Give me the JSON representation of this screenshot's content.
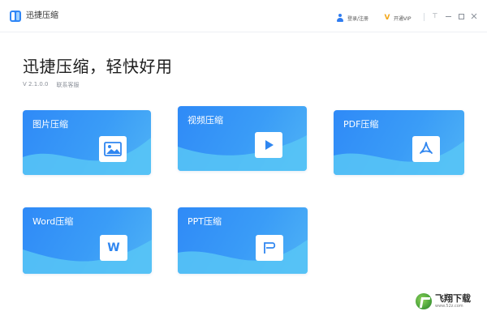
{
  "app": {
    "title": "迅捷压缩"
  },
  "titlebar": {
    "login_label": "登录/注册",
    "vip_label": "开通VIP",
    "pin_glyph": "⊤"
  },
  "hero": {
    "headline": "迅捷压缩，轻快好用",
    "version": "V 2.1.0.0",
    "version_link": "联系客服"
  },
  "cards": [
    {
      "label": "图片压缩",
      "icon": "image-icon"
    },
    {
      "label": "视频压缩",
      "icon": "play-icon"
    },
    {
      "label": "PDF压缩",
      "icon": "pdf-icon"
    },
    {
      "label": "Word压缩",
      "icon": "word-icon",
      "icon_text": "W"
    },
    {
      "label": "PPT压缩",
      "icon": "ppt-icon"
    }
  ],
  "watermark": {
    "name": "飞翔下载",
    "url": "www.52z.com"
  },
  "colors": {
    "accent": "#2f86f6",
    "card_start": "#2f8af7",
    "card_end": "#4fb3f5",
    "wave": "#5ad0f7",
    "vip": "#f3a81c"
  }
}
